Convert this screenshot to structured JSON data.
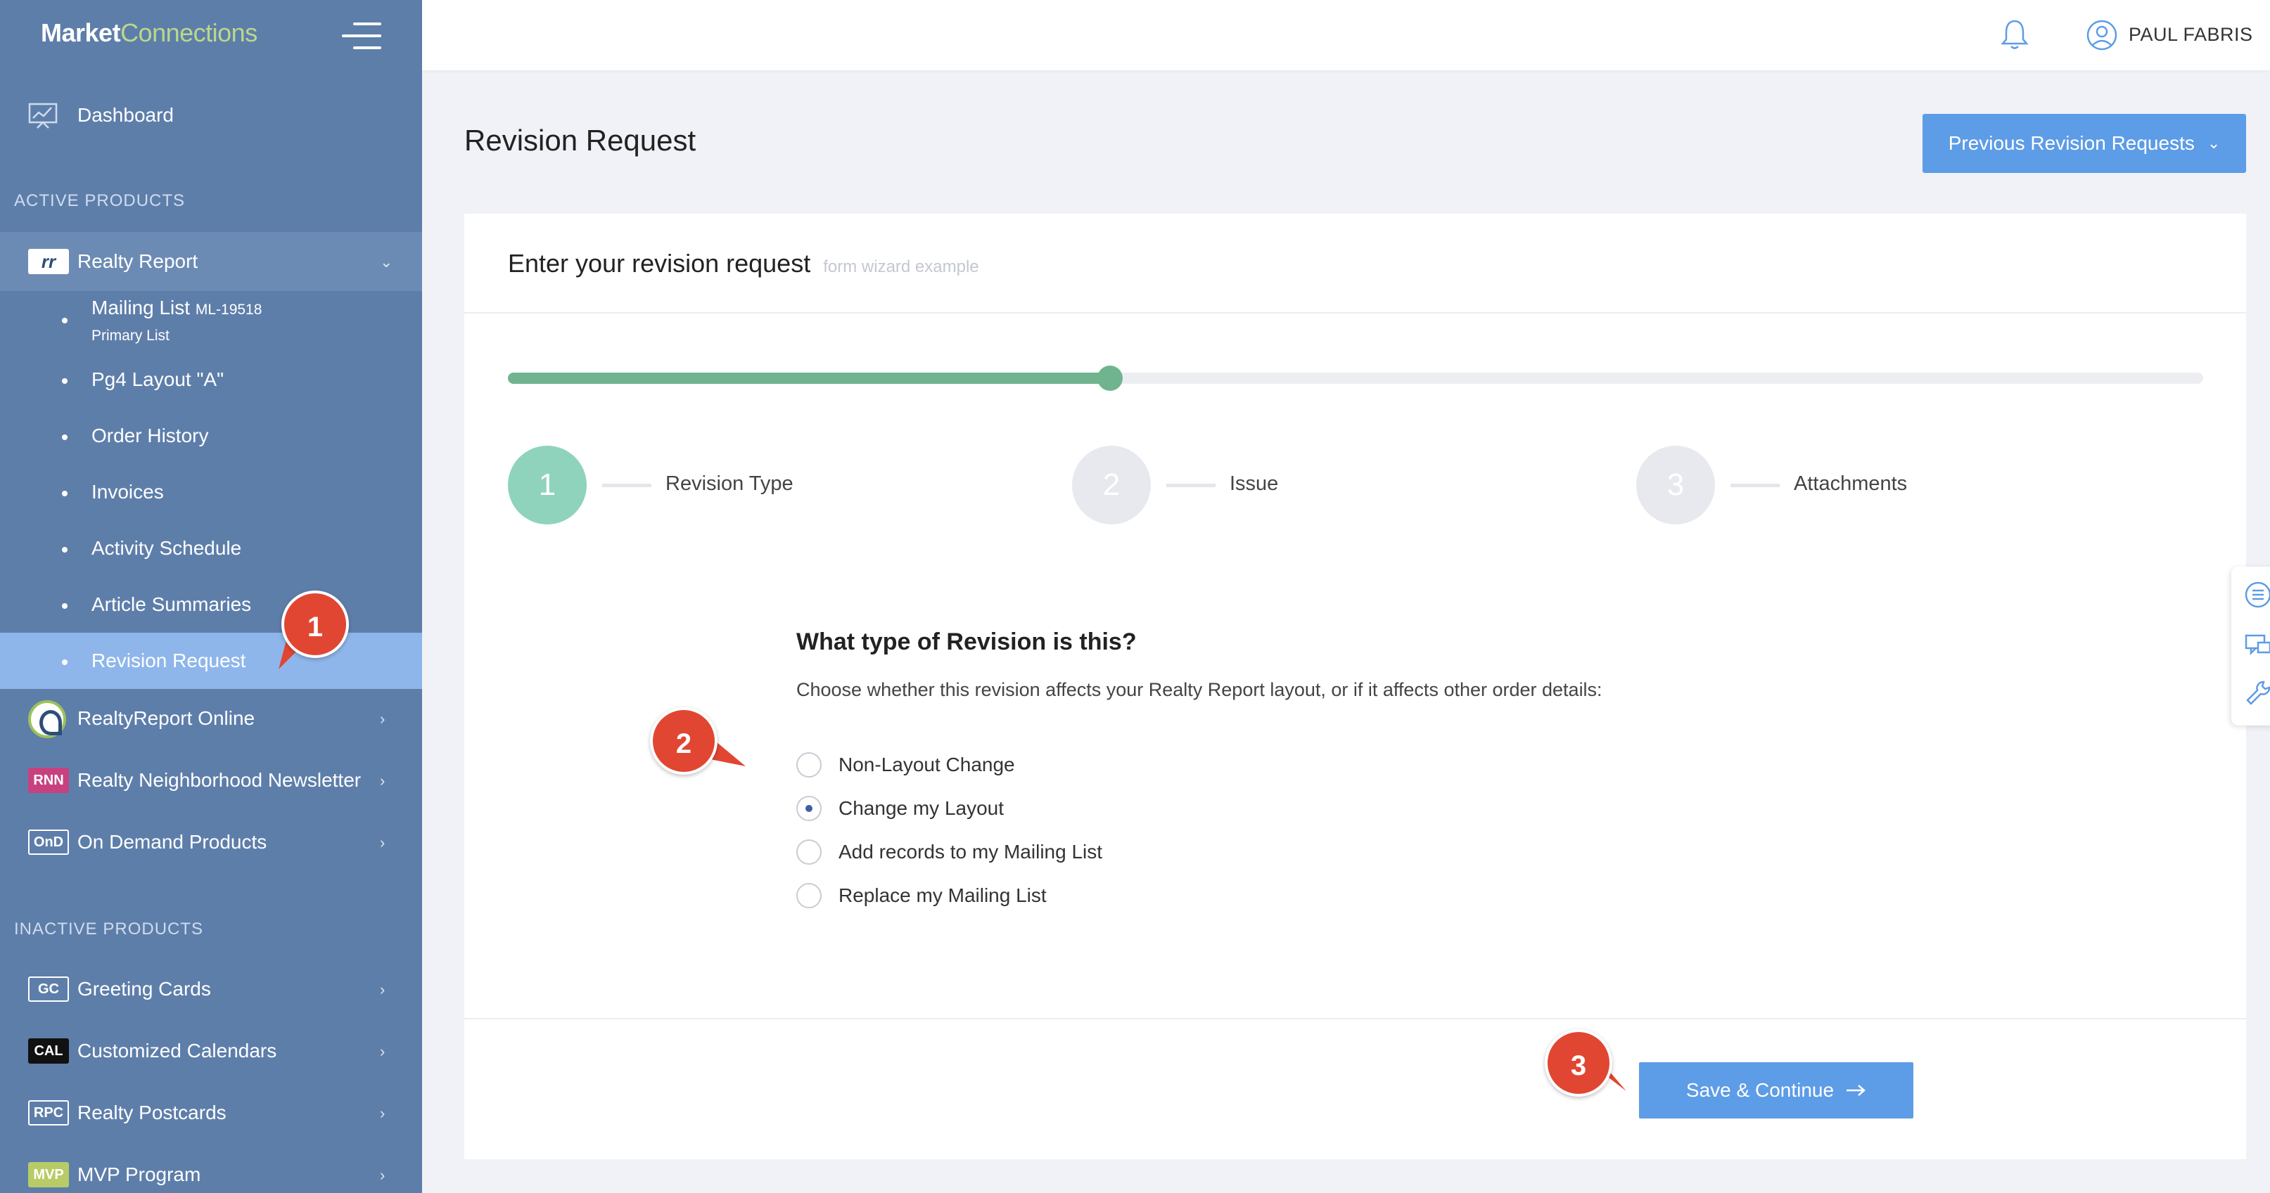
{
  "brand": {
    "part1": "Market",
    "part2": "Connections"
  },
  "sidebar": {
    "dashboard": "Dashboard",
    "active_label": "ACTIVE PRODUCTS",
    "inactive_label": "INACTIVE PRODUCTS",
    "realty_report": {
      "badge": "rr",
      "label": "Realty Report"
    },
    "sub_items": [
      {
        "label": "Mailing List",
        "code": "ML-19518",
        "note": "Primary List"
      },
      {
        "label": "Pg4 Layout \"A\""
      },
      {
        "label": "Order History"
      },
      {
        "label": "Invoices"
      },
      {
        "label": "Activity Schedule"
      },
      {
        "label": "Article Summaries"
      },
      {
        "label": "Revision Request"
      }
    ],
    "active_products": [
      {
        "label": "RealtyReport Online"
      },
      {
        "badge": "RNN",
        "label": "Realty Neighborhood Newsletter"
      },
      {
        "badge": "OnD",
        "label": "On Demand Products"
      }
    ],
    "inactive_products": [
      {
        "badge": "GC",
        "label": "Greeting Cards"
      },
      {
        "badge": "CAL",
        "label": "Customized Calendars"
      },
      {
        "badge": "RPC",
        "label": "Realty Postcards"
      },
      {
        "badge": "MVP",
        "label": "MVP Program"
      }
    ]
  },
  "header": {
    "username": "PAUL FABRIS"
  },
  "page": {
    "title": "Revision Request",
    "prev_button": "Previous Revision Requests"
  },
  "card": {
    "title": "Enter your revision request",
    "subtitle": "form wizard example",
    "progress": 0.355,
    "steps": [
      {
        "num": "1",
        "label": "Revision Type"
      },
      {
        "num": "2",
        "label": "Issue"
      },
      {
        "num": "3",
        "label": "Attachments"
      }
    ],
    "question": "What type of Revision is this?",
    "help": "Choose whether this revision affects your Realty Report layout, or if it affects other order details:",
    "options": [
      "Non-Layout Change",
      "Change my Layout",
      "Add records to my Mailing List",
      "Replace my Mailing List"
    ],
    "selected_option": 1,
    "save_button": "Save & Continue"
  },
  "callouts": [
    "1",
    "2",
    "3"
  ],
  "colors": {
    "sidebar": "#5e7eaa",
    "selected_item": "#8fb6ea",
    "accent_button": "#5d9ce6",
    "progress": "#6fb48e",
    "callout": "#e14632"
  }
}
